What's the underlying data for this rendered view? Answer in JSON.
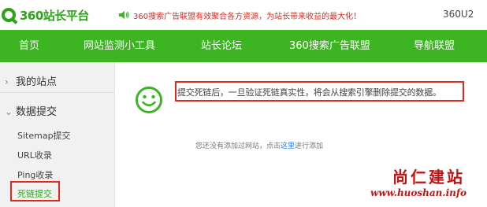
{
  "header": {
    "logo_text": "360站长平台",
    "notice_text": "360搜索广告联盟有效聚合各方资源，为站长带来收益的最大化！",
    "corner_text": "360U2"
  },
  "nav": {
    "items": [
      {
        "label": "首页"
      },
      {
        "label": "网站监测小工具"
      },
      {
        "label": "站长论坛"
      },
      {
        "label": "360搜索广告联盟"
      },
      {
        "label": "导航联盟"
      }
    ]
  },
  "sidebar": {
    "groups": [
      {
        "label": "我的站点",
        "chevron": "›"
      },
      {
        "label": "数据提交",
        "chevron": "⌄"
      }
    ],
    "items": [
      {
        "label": "Sitemap提交"
      },
      {
        "label": "URL收录"
      },
      {
        "label": "Ping收录"
      },
      {
        "label": "死链提交"
      }
    ],
    "active_index": 3
  },
  "main": {
    "message": "提交死链后，一旦验证死链真实性，将会从搜索引擎删除提交的数据。",
    "empty_prefix": "您还没有添加过网站，点击",
    "empty_link": "这里",
    "empty_suffix": "进行添加"
  },
  "watermark": {
    "title": "尚仁建站",
    "url": "www.huoshan.info"
  },
  "colors": {
    "brand_green": "#3db523",
    "logo_green": "#2aa515",
    "highlight_red": "#e0281e",
    "watermark_red": "#c41212",
    "link_blue": "#2a7ad6"
  },
  "icons": [
    "logo-360-icon",
    "speaker-icon",
    "smiley-icon",
    "chevron-right-icon",
    "chevron-down-icon"
  ]
}
